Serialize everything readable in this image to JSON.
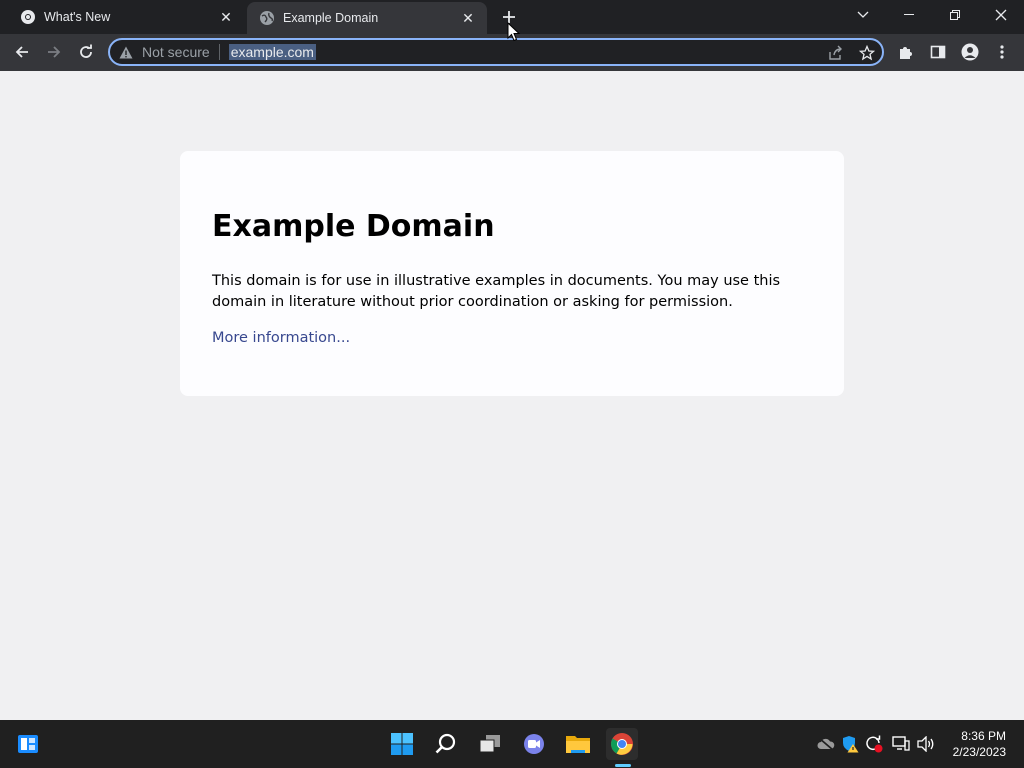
{
  "tabs": [
    {
      "title": "What's New",
      "favicon": "chrome-icon"
    },
    {
      "title": "Example Domain",
      "favicon": "globe-icon"
    }
  ],
  "omnibox": {
    "security_label": "Not secure",
    "url": "example.com"
  },
  "page": {
    "heading": "Example Domain",
    "description": "This domain is for use in illustrative examples in documents. You may use this domain in literature without prior coordination or asking for permission.",
    "link_text": "More information..."
  },
  "taskbar": {
    "apps": [
      "widgets-icon",
      "start-icon",
      "search-icon",
      "task-view-icon",
      "chat-icon",
      "file-explorer-icon",
      "chrome-icon"
    ],
    "clock_time": "8:36 PM",
    "clock_date": "2/23/2023"
  },
  "colors": {
    "titlebar": "#202124",
    "toolbar": "#35363a",
    "omnibox_border": "#8ab4f8",
    "page_bg": "#f0f0f2",
    "link": "#38488f",
    "taskbar": "#202020"
  }
}
